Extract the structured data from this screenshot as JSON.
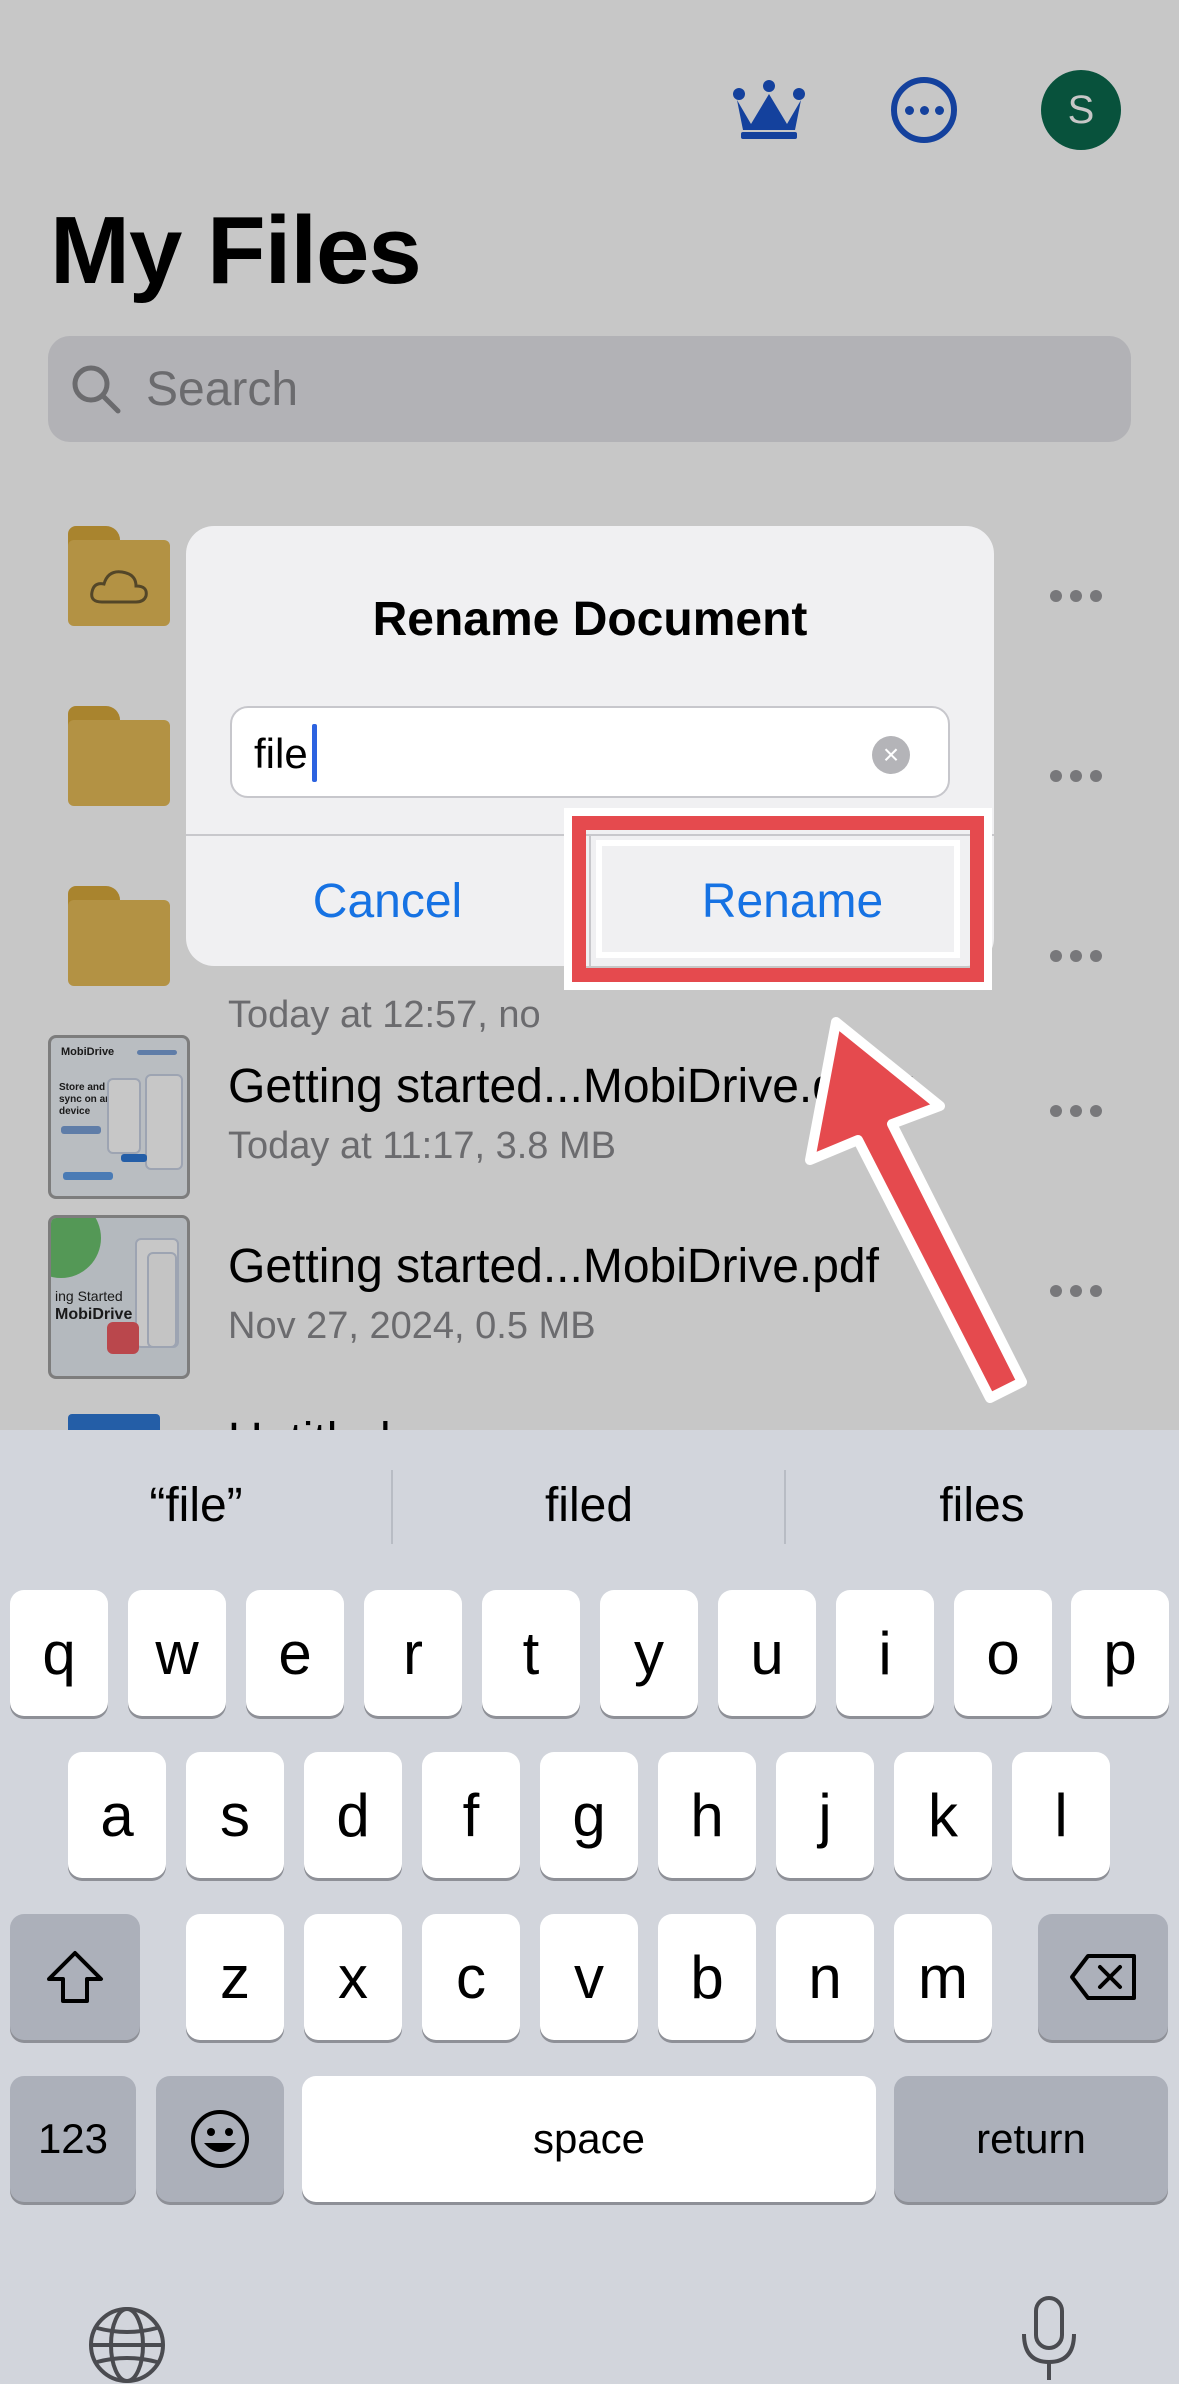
{
  "header": {
    "crown_icon": "crown-icon",
    "more_icon": "ellipsis-circle-icon",
    "avatar_initial": "S",
    "title": "My Files"
  },
  "search": {
    "placeholder": "Search"
  },
  "files": [
    {
      "name": "",
      "meta": "",
      "type": "cloud-folder"
    },
    {
      "name": "",
      "meta": "",
      "type": "folder"
    },
    {
      "name": "",
      "meta": "Today at 12:57, no",
      "type": "folder"
    },
    {
      "name": "Getting started...MobiDrive.docx",
      "meta": "Today at 11:17, 3.8 MB",
      "type": "docx"
    },
    {
      "name": "Getting started...MobiDrive.pdf",
      "meta": "Nov 27, 2024, 0.5 MB",
      "type": "pdf"
    },
    {
      "name": "Untitled",
      "meta": "",
      "type": "doc"
    }
  ],
  "thumbs": {
    "docx_brand": "MobiDrive",
    "docx_caption": "Store and sync on any device",
    "pdf_caption_1": "ing Started",
    "pdf_caption_2": "MobiDrive"
  },
  "dialog": {
    "title": "Rename Document",
    "input_value": "file",
    "cancel_label": "Cancel",
    "rename_label": "Rename"
  },
  "keyboard": {
    "suggestions": [
      "“file”",
      "filed",
      "files"
    ],
    "row1": [
      "q",
      "w",
      "e",
      "r",
      "t",
      "y",
      "u",
      "i",
      "o",
      "p"
    ],
    "row2": [
      "a",
      "s",
      "d",
      "f",
      "g",
      "h",
      "j",
      "k",
      "l"
    ],
    "row3": [
      "z",
      "x",
      "c",
      "v",
      "b",
      "n",
      "m"
    ],
    "numbers_label": "123",
    "space_label": "space",
    "return_label": "return"
  },
  "colors": {
    "accent": "#1672e3",
    "highlight": "#e54a4e",
    "avatar": "#0b6a4e"
  }
}
